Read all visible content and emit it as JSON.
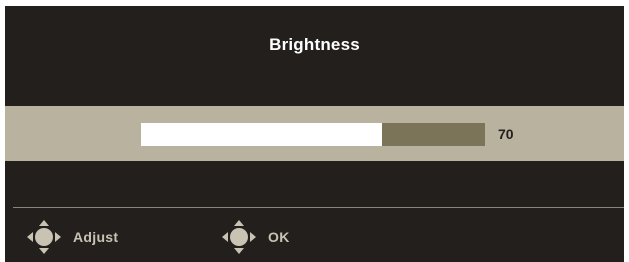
{
  "osd": {
    "title": "Brightness",
    "slider": {
      "value": 70,
      "value_label": "70"
    }
  },
  "footer": {
    "items": [
      {
        "icon": "joystick-adjust-icon",
        "label": "Adjust"
      },
      {
        "icon": "joystick-ok-icon",
        "label": "OK"
      }
    ]
  },
  "colors": {
    "background": "#231f1c",
    "band": "#b9b29f",
    "track": "#7b7458",
    "fill": "#ffffff",
    "footer_text": "#c9c3b4"
  }
}
